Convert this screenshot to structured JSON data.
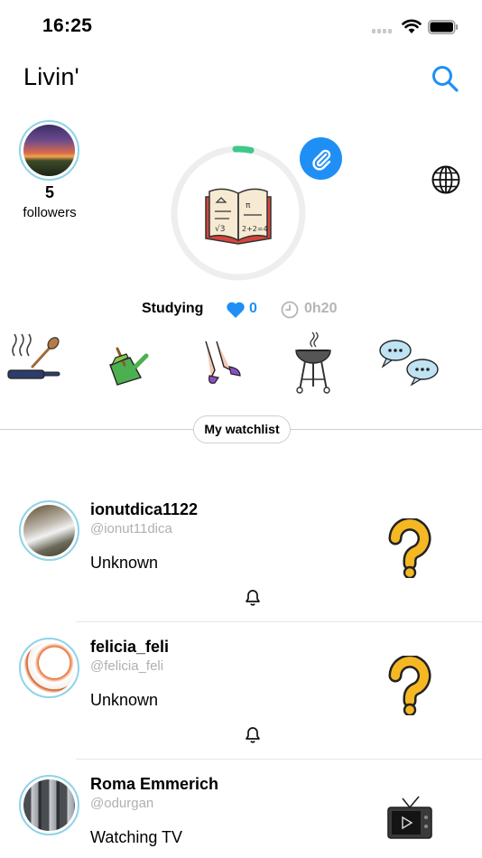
{
  "status_bar": {
    "time": "16:25"
  },
  "header": {
    "title": "Livin'",
    "search_icon": "search-icon"
  },
  "profile": {
    "followers_count": "5",
    "followers_label": "followers",
    "current_activity": "Studying",
    "likes": "0",
    "duration": "0h20",
    "activity_icon": "open-book-icon",
    "accent_color": "#1f8ff5",
    "progress_color": "#3cc98a"
  },
  "activities": [
    {
      "name": "cooking-icon"
    },
    {
      "name": "cleaning-icon"
    },
    {
      "name": "dancing-icon"
    },
    {
      "name": "barbecue-icon"
    },
    {
      "name": "chatting-icon"
    }
  ],
  "watchlist": {
    "label": "My watchlist"
  },
  "feed": [
    {
      "name": "ionutdica1122",
      "handle": "@ionut11dica",
      "status": "Unknown",
      "status_icon": "question-mark-icon"
    },
    {
      "name": "felicia_feli",
      "handle": "@felicia_feli",
      "status": "Unknown",
      "status_icon": "question-mark-icon"
    },
    {
      "name": "Roma Emmerich",
      "handle": "@odurgan",
      "status": "Watching TV",
      "status_icon": "tv-icon"
    }
  ]
}
